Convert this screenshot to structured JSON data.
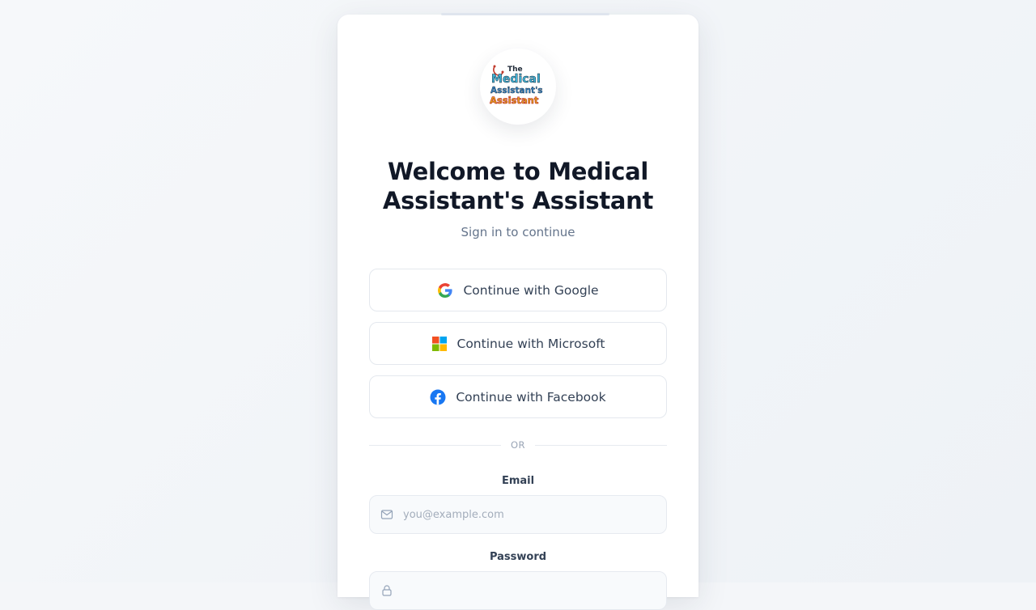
{
  "header": {
    "title": "Welcome to Medical Assistant's Assistant",
    "subtitle": "Sign in to continue"
  },
  "logo": {
    "line1": "The",
    "line2": "Medical",
    "line3": "Assistant's",
    "line4": "Assistant"
  },
  "sso": {
    "google_label": "Continue with Google",
    "microsoft_label": "Continue with Microsoft",
    "facebook_label": "Continue with Facebook"
  },
  "divider": {
    "label": "OR"
  },
  "form": {
    "email_label": "Email",
    "email_placeholder": "you@example.com",
    "password_label": "Password"
  },
  "colors": {
    "google_blue": "#4285F4",
    "google_red": "#EA4335",
    "google_yellow": "#FBBC05",
    "google_green": "#34A853",
    "ms_red": "#F25022",
    "ms_green": "#7FBA00",
    "ms_blue": "#00A4EF",
    "ms_yellow": "#FFB900",
    "facebook_blue": "#1877F2"
  }
}
